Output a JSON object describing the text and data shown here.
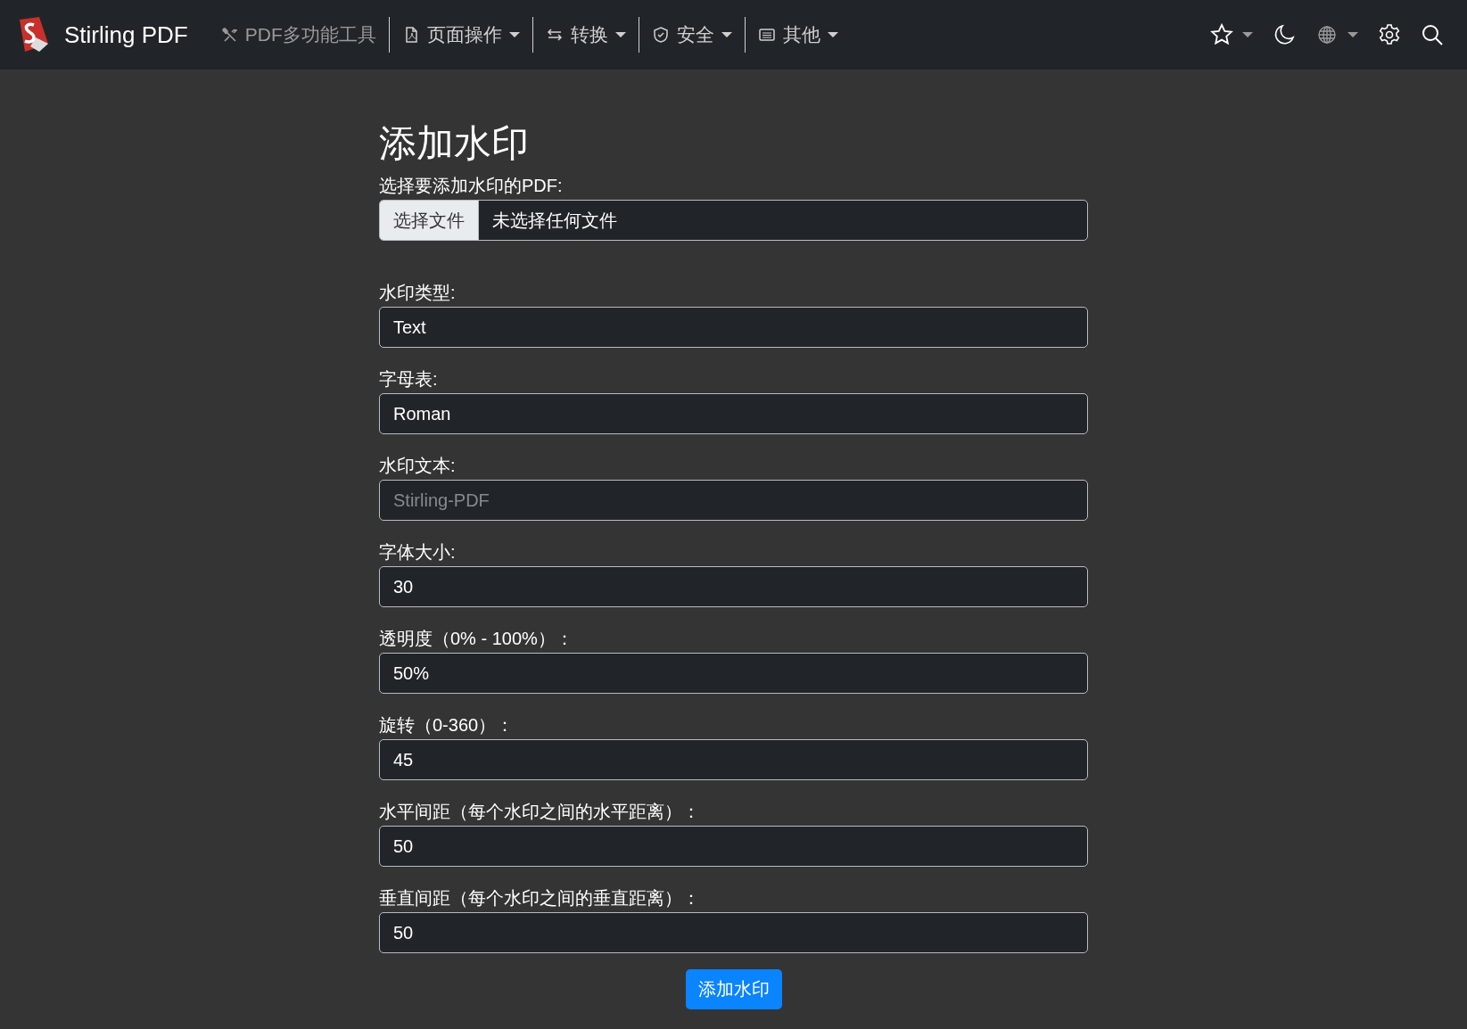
{
  "navbar": {
    "brand": "Stirling PDF",
    "items": [
      {
        "label": "PDF多功能工具",
        "kind": "tools",
        "dropdown": false,
        "disabled": true
      },
      {
        "label": "页面操作",
        "kind": "file",
        "dropdown": true,
        "disabled": false
      },
      {
        "label": "转换",
        "kind": "arrows",
        "dropdown": true,
        "disabled": false
      },
      {
        "label": "安全",
        "kind": "shield",
        "dropdown": true,
        "disabled": false
      },
      {
        "label": "其他",
        "kind": "list",
        "dropdown": true,
        "disabled": false
      }
    ]
  },
  "form": {
    "title": "添加水印",
    "fields": [
      {
        "kind": "file",
        "label": "选择要添加水印的PDF:",
        "button": "选择文件",
        "value": "未选择任何文件"
      },
      {
        "kind": "input",
        "label": "水印类型:",
        "value": "Text"
      },
      {
        "kind": "input",
        "label": "字母表:",
        "value": "Roman"
      },
      {
        "kind": "input",
        "label": "水印文本:",
        "placeholder": "Stirling-PDF"
      },
      {
        "kind": "input",
        "label": "字体大小:",
        "value": "30"
      },
      {
        "kind": "input",
        "label": "透明度（0% - 100%）：",
        "value": "50%"
      },
      {
        "kind": "input",
        "label": "旋转（0-360）：",
        "value": "45"
      },
      {
        "kind": "input",
        "label": "水平间距（每个水印之间的水平距离）：",
        "value": "50"
      },
      {
        "kind": "input",
        "label": "垂直间距（每个水印之间的垂直距离）：",
        "value": "50"
      }
    ],
    "submit": "添加水印"
  }
}
